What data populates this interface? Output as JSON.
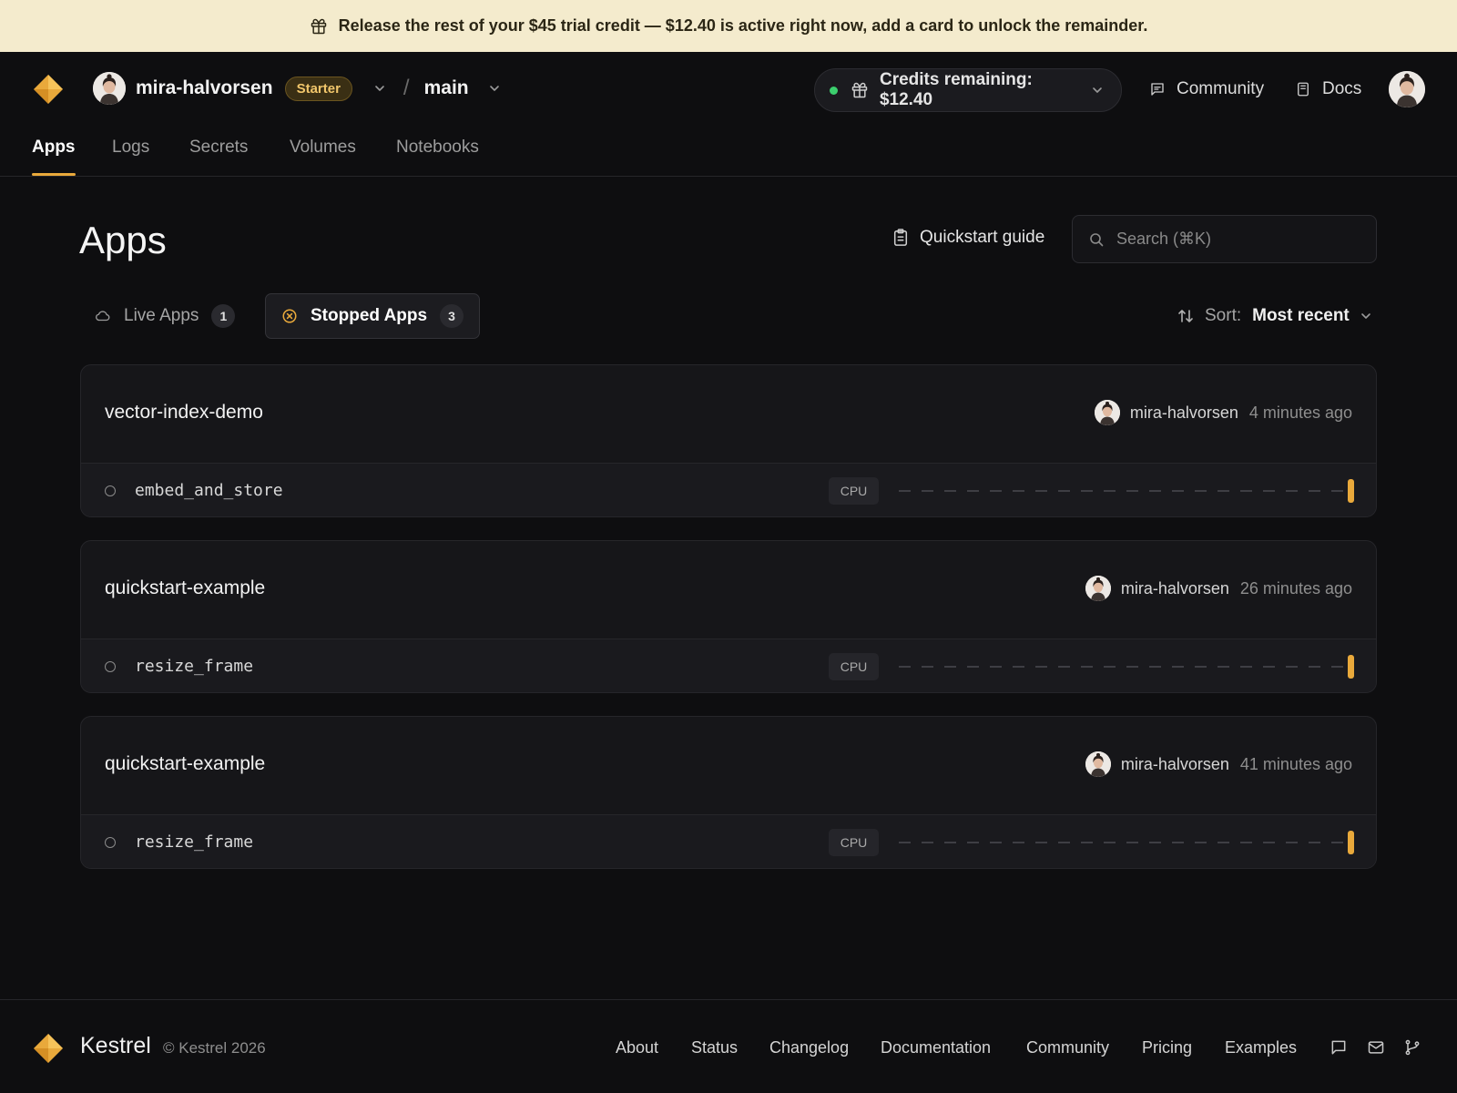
{
  "banner": {
    "text": "Release the rest of your $45 trial credit — $12.40 is active right now, add a card to unlock the remainder.",
    "icon": "gift-icon"
  },
  "header": {
    "workspace_name": "mira-halvorsen",
    "plan": "Starter",
    "environment": "main",
    "credits_label": "Credits remaining: $12.40",
    "credits_status_color": "#3ccf6e",
    "community": "Community",
    "docs": "Docs"
  },
  "nav": {
    "tabs": [
      "Apps",
      "Logs",
      "Secrets",
      "Volumes",
      "Notebooks"
    ],
    "active": "Apps"
  },
  "page": {
    "title": "Apps",
    "quickstart": "Quickstart guide",
    "search_placeholder": "Search (⌘K)"
  },
  "filters": {
    "live_label": "Live Apps",
    "live_count": "1",
    "stopped_label": "Stopped Apps",
    "stopped_count": "3"
  },
  "sort": {
    "label": "Sort:",
    "value": "Most recent"
  },
  "apps": [
    {
      "name": "vector-index-demo",
      "owner": "mira-halvorsen",
      "time": "4 minutes ago",
      "function": "embed_and_store",
      "resource": "CPU"
    },
    {
      "name": "quickstart-example",
      "owner": "mira-halvorsen",
      "time": "26 minutes ago",
      "function": "resize_frame",
      "resource": "CPU"
    },
    {
      "name": "quickstart-example",
      "owner": "mira-halvorsen",
      "time": "41 minutes ago",
      "function": "resize_frame",
      "resource": "CPU"
    }
  ],
  "footer": {
    "brand": "Kestrel",
    "copyright": "© Kestrel 2026",
    "links": [
      "About",
      "Status",
      "Changelog",
      "Documentation",
      "Community",
      "Pricing",
      "Examples"
    ],
    "icons": [
      "chat-icon",
      "mail-icon",
      "git-branch-icon"
    ]
  },
  "colors": {
    "accent": "#e9a93b",
    "banner_bg": "#f4ebcd",
    "background": "#0e0e10"
  }
}
